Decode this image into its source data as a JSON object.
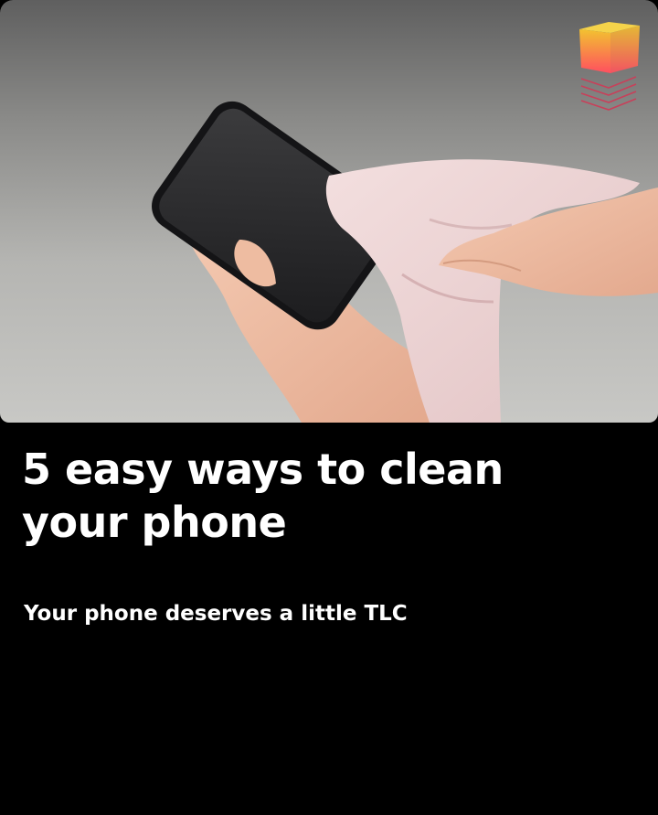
{
  "card": {
    "headline": "5 easy ways to clean your phone",
    "subtitle": "Your phone deserves a little TLC",
    "image_alt": "Hands wiping a smartphone screen with a pink microfiber cloth"
  },
  "logo": {
    "icon": "open-box-icon",
    "colors": [
      "#f2c230",
      "#ff4f5f",
      "#c8405a"
    ]
  }
}
